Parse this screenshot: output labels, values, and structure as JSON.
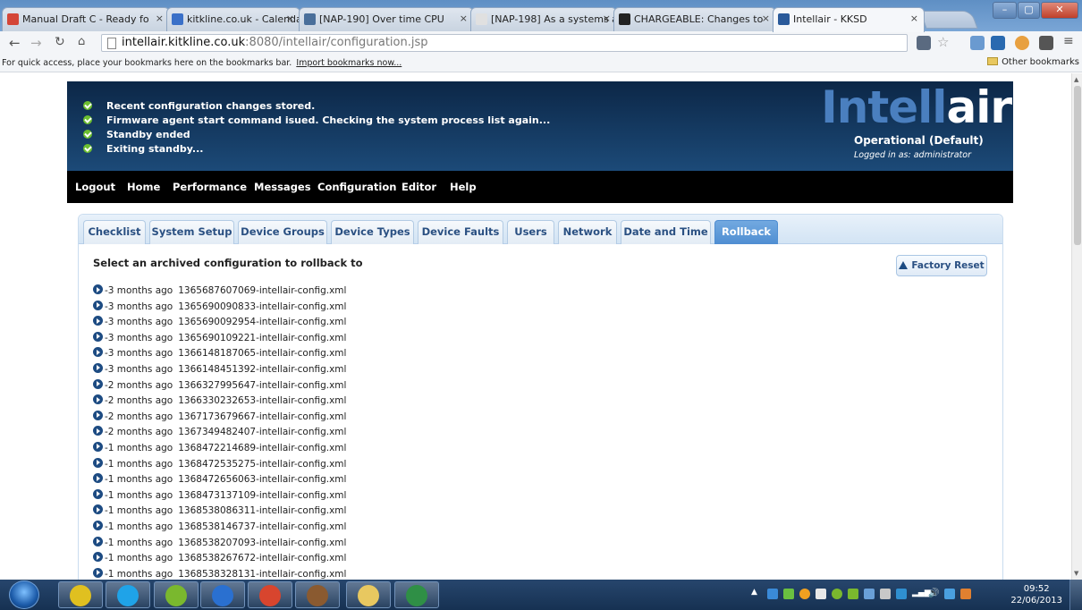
{
  "browser": {
    "tabs": [
      {
        "title": "Manual Draft C - Ready fo",
        "icon": "gmail-icon",
        "icon_color": "#d44638"
      },
      {
        "title": "kitkline.co.uk - Calendar",
        "icon": "calendar-icon",
        "icon_color": "#3a70c8"
      },
      {
        "title": "[NAP-190] Over time CPU",
        "icon": "jira-icon",
        "icon_color": "#4a6f9a"
      },
      {
        "title": "[NAP-198] As a systems a",
        "icon": "page-icon",
        "icon_color": "#e0e0e0"
      },
      {
        "title": "CHARGEABLE: Changes to",
        "icon": "github-icon",
        "icon_color": "#222222"
      },
      {
        "title": "Intellair - KKSD",
        "icon": "intellair-icon",
        "icon_color": "#2a5a9a",
        "active": true
      }
    ],
    "url_host": "intellair.kitkline.co.uk",
    "url_rest": ":8080/intellair/configuration.jsp",
    "bookmarks_text": "For quick access, place your bookmarks here on the bookmarks bar.",
    "bookmarks_link": "Import bookmarks now...",
    "other_bookmarks": "Other bookmarks"
  },
  "app": {
    "status_messages": [
      "Recent configuration changes stored.",
      "Firmware agent start command isued. Checking the system process list again...",
      "Standby ended",
      "Exiting standby..."
    ],
    "logo_part1": "Intell",
    "logo_part2": "air",
    "mode": "Operational (Default)",
    "logged_in": "Logged in as: administrator",
    "menu": [
      "Logout",
      "Home",
      "Performance",
      "Messages",
      "Configuration",
      "Editor",
      "Help"
    ],
    "tabs": [
      "Checklist",
      "System Setup",
      "Device Groups",
      "Device Types",
      "Device Faults",
      "Users",
      "Network",
      "Date and Time",
      "Rollback"
    ],
    "active_tab": "Rollback",
    "heading": "Select an archived configuration to rollback to",
    "factory_reset": "Factory Reset",
    "configs": [
      {
        "age": "-3 months ago",
        "file": "1365687607069-intellair-config.xml"
      },
      {
        "age": "-3 months ago",
        "file": "1365690090833-intellair-config.xml"
      },
      {
        "age": "-3 months ago",
        "file": "1365690092954-intellair-config.xml"
      },
      {
        "age": "-3 months ago",
        "file": "1365690109221-intellair-config.xml"
      },
      {
        "age": "-3 months ago",
        "file": "1366148187065-intellair-config.xml"
      },
      {
        "age": "-3 months ago",
        "file": "1366148451392-intellair-config.xml"
      },
      {
        "age": "-2 months ago",
        "file": "1366327995647-intellair-config.xml"
      },
      {
        "age": "-2 months ago",
        "file": "1366330232653-intellair-config.xml"
      },
      {
        "age": "-2 months ago",
        "file": "1367173679667-intellair-config.xml"
      },
      {
        "age": "-2 months ago",
        "file": "1367349482407-intellair-config.xml"
      },
      {
        "age": "-1 months ago",
        "file": "1368472214689-intellair-config.xml"
      },
      {
        "age": "-1 months ago",
        "file": "1368472535275-intellair-config.xml"
      },
      {
        "age": "-1 months ago",
        "file": "1368472656063-intellair-config.xml"
      },
      {
        "age": "-1 months ago",
        "file": "1368473137109-intellair-config.xml"
      },
      {
        "age": "-1 months ago",
        "file": "1368538086311-intellair-config.xml"
      },
      {
        "age": "-1 months ago",
        "file": "1368538146737-intellair-config.xml"
      },
      {
        "age": "-1 months ago",
        "file": "1368538207093-intellair-config.xml"
      },
      {
        "age": "-1 months ago",
        "file": "1368538267672-intellair-config.xml"
      },
      {
        "age": "-1 months ago",
        "file": "1368538328131-intellair-config.xml"
      }
    ]
  },
  "taskbar": {
    "apps": [
      {
        "name": "winamp-icon",
        "color": "#e0c020"
      },
      {
        "name": "skype-icon",
        "color": "#1fa3e8"
      },
      {
        "name": "spotify-icon",
        "color": "#7ab82e"
      },
      {
        "name": "teamviewer-icon",
        "color": "#2a70d0"
      },
      {
        "name": "chrome-icon",
        "color": "#d8452e"
      },
      {
        "name": "settings-app-icon",
        "color": "#8a5a30"
      },
      {
        "name": "file-explorer-icon",
        "color": "#e8c860"
      },
      {
        "name": "excel-icon",
        "color": "#2f8f46"
      }
    ],
    "time": "09:52",
    "date": "22/06/2013"
  }
}
